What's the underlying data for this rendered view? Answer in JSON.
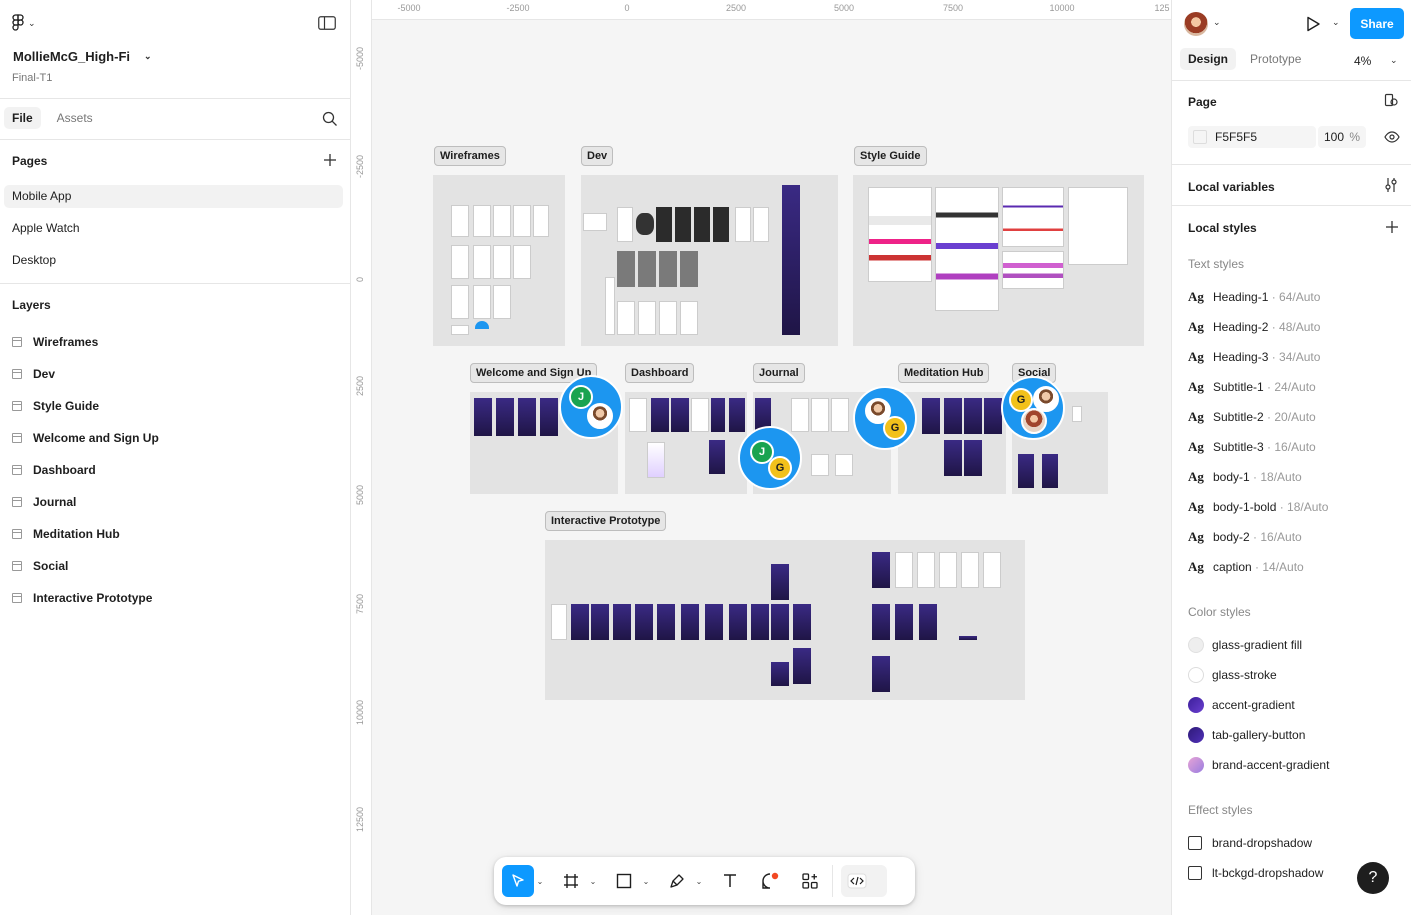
{
  "file": {
    "name": "MollieMcG_High-Fi",
    "subtitle": "Final-T1"
  },
  "left_tabs": [
    "File",
    "Assets"
  ],
  "pages": {
    "title": "Pages",
    "items": [
      "Mobile App",
      "Apple Watch",
      "Desktop"
    ]
  },
  "layers": {
    "title": "Layers",
    "items": [
      "Wireframes",
      "Dev",
      "Style Guide",
      "Welcome and Sign Up",
      "Dashboard",
      "Journal",
      "Meditation Hub",
      "Social",
      "Interactive Prototype"
    ]
  },
  "rulers": {
    "top": [
      "-5000",
      "-2500",
      "0",
      "2500",
      "5000",
      "7500",
      "10000",
      "125"
    ],
    "left": [
      "-5000",
      "-2500",
      "0",
      "2500",
      "5000",
      "7500",
      "10000",
      "12500"
    ]
  },
  "canvas_frames": {
    "wireframes": "Wireframes",
    "dev": "Dev",
    "style_guide": "Style Guide",
    "welcome": "Welcome and Sign Up",
    "dashboard": "Dashboard",
    "journal": "Journal",
    "meditation": "Meditation Hub",
    "social": "Social",
    "prototype": "Interactive Prototype"
  },
  "collaborators": {
    "j": "J",
    "g": "G"
  },
  "right_panel": {
    "share_label": "Share",
    "tabs": [
      "Design",
      "Prototype"
    ],
    "zoom": "4%",
    "page_title": "Page",
    "page_color": "F5F5F5",
    "page_opacity": "100",
    "page_opacity_unit": "%",
    "local_variables": "Local variables",
    "local_styles": "Local styles",
    "text_styles_title": "Text styles",
    "ag": "Ag",
    "text_styles": [
      {
        "name": "Heading-1",
        "meta": " · 64/Auto"
      },
      {
        "name": "Heading-2",
        "meta": " · 48/Auto"
      },
      {
        "name": "Heading-3",
        "meta": " · 34/Auto"
      },
      {
        "name": "Subtitle-1",
        "meta": " · 24/Auto"
      },
      {
        "name": "Subtitle-2",
        "meta": " · 20/Auto"
      },
      {
        "name": "Subtitle-3",
        "meta": " · 16/Auto"
      },
      {
        "name": "body-1",
        "meta": " · 18/Auto"
      },
      {
        "name": "body-1-bold",
        "meta": " · 18/Auto"
      },
      {
        "name": "body-2",
        "meta": " · 16/Auto"
      },
      {
        "name": "caption",
        "meta": " · 14/Auto"
      }
    ],
    "color_styles_title": "Color styles",
    "color_styles": [
      {
        "name": "glass-gradient fill",
        "color": "#eeeeee"
      },
      {
        "name": "glass-stroke",
        "color": "#ffffff"
      },
      {
        "name": "accent-gradient",
        "color": "#4a2aa0"
      },
      {
        "name": "tab-gallery-button",
        "color": "#3a2590"
      },
      {
        "name": "brand-accent-gradient",
        "color": "#c98ad8"
      }
    ],
    "effect_styles_title": "Effect styles",
    "effect_styles": [
      "brand-dropshadow",
      "lt-bckgd-dropshadow"
    ],
    "help": "?"
  },
  "colors": {
    "accent": "#0d99ff",
    "purple": "#2a1f5a"
  }
}
